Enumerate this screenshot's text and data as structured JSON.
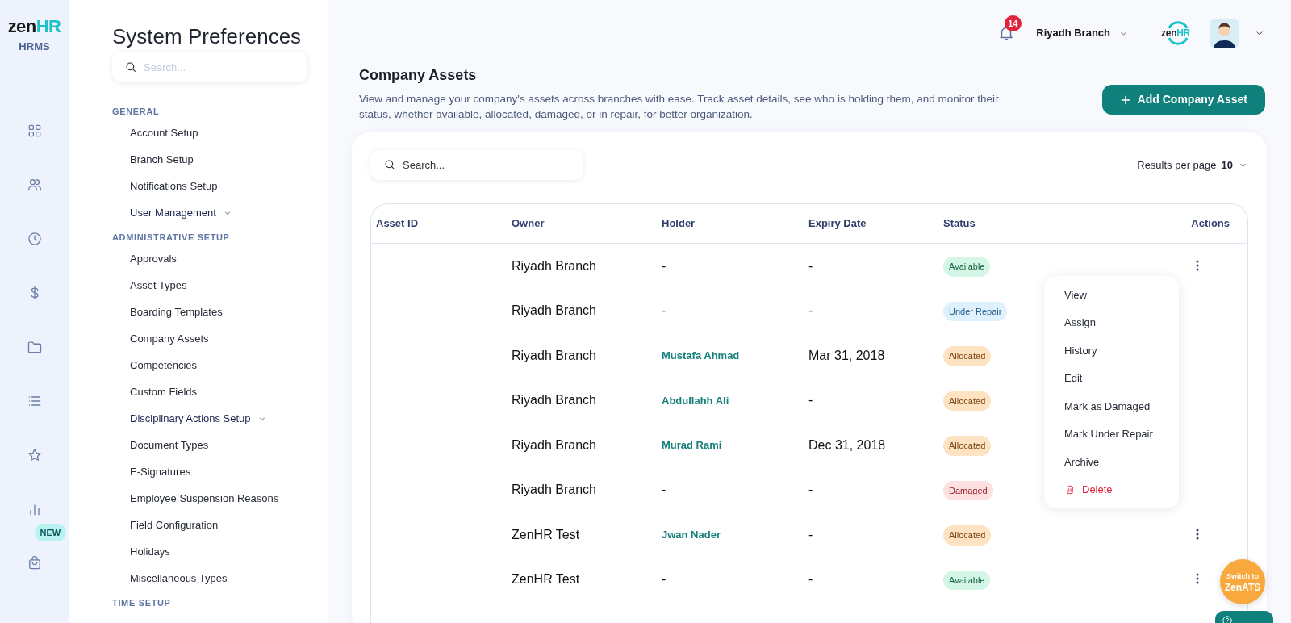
{
  "brand": {
    "logo_left": "zen",
    "logo_right": "HR",
    "product": "HRMS",
    "rail_badge": "NEW"
  },
  "preferences": {
    "title": "System Preferences",
    "search": {
      "placeholder": "Search..."
    },
    "sections": [
      {
        "heading": "GENERAL",
        "items": [
          {
            "label": "Account Setup",
            "kind": "link"
          },
          {
            "label": "Branch Setup",
            "kind": "link"
          },
          {
            "label": "Notifications Setup",
            "kind": "link"
          },
          {
            "label": "User Management",
            "kind": "group"
          }
        ]
      },
      {
        "heading": "ADMINISTRATIVE SETUP",
        "items": [
          {
            "label": "Approvals",
            "kind": "link"
          },
          {
            "label": "Asset Types",
            "kind": "link"
          },
          {
            "label": "Boarding Templates",
            "kind": "link"
          },
          {
            "label": "Company Assets",
            "kind": "link"
          },
          {
            "label": "Competencies",
            "kind": "link"
          },
          {
            "label": "Custom Fields",
            "kind": "link"
          },
          {
            "label": "Disciplinary Actions Setup",
            "kind": "group"
          },
          {
            "label": "Document Types",
            "kind": "link"
          },
          {
            "label": "E-Signatures",
            "kind": "link"
          },
          {
            "label": "Employee Suspension Reasons",
            "kind": "link"
          },
          {
            "label": "Field Configuration",
            "kind": "link"
          },
          {
            "label": "Holidays",
            "kind": "link"
          },
          {
            "label": "Miscellaneous Types",
            "kind": "link"
          }
        ]
      },
      {
        "heading": "TIME SETUP"
      }
    ]
  },
  "header": {
    "notification_count": "14",
    "branch": "Riyadh Branch",
    "logo_left": "zen",
    "logo_right": "HR"
  },
  "page": {
    "title": "Company Assets",
    "description": "View and manage your company's assets across branches with ease. Track asset details, see who is holding them, and monitor their status, whether available, allocated, damaged, or in repair, for better organization.",
    "add_button": "Add Company Asset"
  },
  "table": {
    "search": {
      "placeholder": "Search..."
    },
    "results_per_page_label": "Results per page",
    "results_per_page": "10",
    "columns": [
      "Asset ID",
      "Owner",
      "Holder",
      "Expiry Date",
      "Status",
      "Actions"
    ],
    "rows": [
      {
        "owner": "Riyadh Branch",
        "holder": "-",
        "expiry_date": "-",
        "status": {
          "label": "Available",
          "kind": "available"
        },
        "menu_button_visible": true
      },
      {
        "owner": "Riyadh Branch",
        "holder": "-",
        "expiry_date": "-",
        "status": {
          "label": "Under Repair",
          "kind": "under_repair"
        },
        "menu_button_visible": false
      },
      {
        "owner": "Riyadh Branch",
        "holder": "Mustafa Ahmad",
        "expiry_date": "Mar 31, 2018",
        "status": {
          "label": "Allocated",
          "kind": "allocated"
        },
        "menu_button_visible": false
      },
      {
        "owner": "Riyadh Branch",
        "holder": "Abdullahh Ali",
        "expiry_date": "-",
        "status": {
          "label": "Allocated",
          "kind": "allocated"
        },
        "menu_button_visible": false
      },
      {
        "owner": "Riyadh Branch",
        "holder": "Murad Rami",
        "expiry_date": "Dec 31, 2018",
        "status": {
          "label": "Allocated",
          "kind": "allocated"
        },
        "menu_button_visible": false
      },
      {
        "owner": "Riyadh Branch",
        "holder": "-",
        "expiry_date": "-",
        "status": {
          "label": "Damaged",
          "kind": "damaged"
        },
        "menu_button_visible": false
      },
      {
        "owner": "ZenHR Test",
        "holder": "Jwan Nader",
        "expiry_date": "-",
        "status": {
          "label": "Allocated",
          "kind": "allocated"
        },
        "menu_button_visible": true
      },
      {
        "owner": "ZenHR Test",
        "holder": "-",
        "expiry_date": "-",
        "status": {
          "label": "Available",
          "kind": "available"
        },
        "menu_button_visible": true
      }
    ]
  },
  "action_menu": [
    {
      "label": "View",
      "kind": "normal"
    },
    {
      "label": "Assign",
      "kind": "normal"
    },
    {
      "label": "History",
      "kind": "normal"
    },
    {
      "label": "Edit",
      "kind": "normal"
    },
    {
      "label": "Mark as Damaged",
      "kind": "normal"
    },
    {
      "label": "Mark Under Repair",
      "kind": "normal"
    },
    {
      "label": "Archive",
      "kind": "normal"
    },
    {
      "label": "Delete",
      "kind": "danger"
    }
  ],
  "switch_button": {
    "line_1": "Switch to",
    "line_2": "ZenATS"
  }
}
